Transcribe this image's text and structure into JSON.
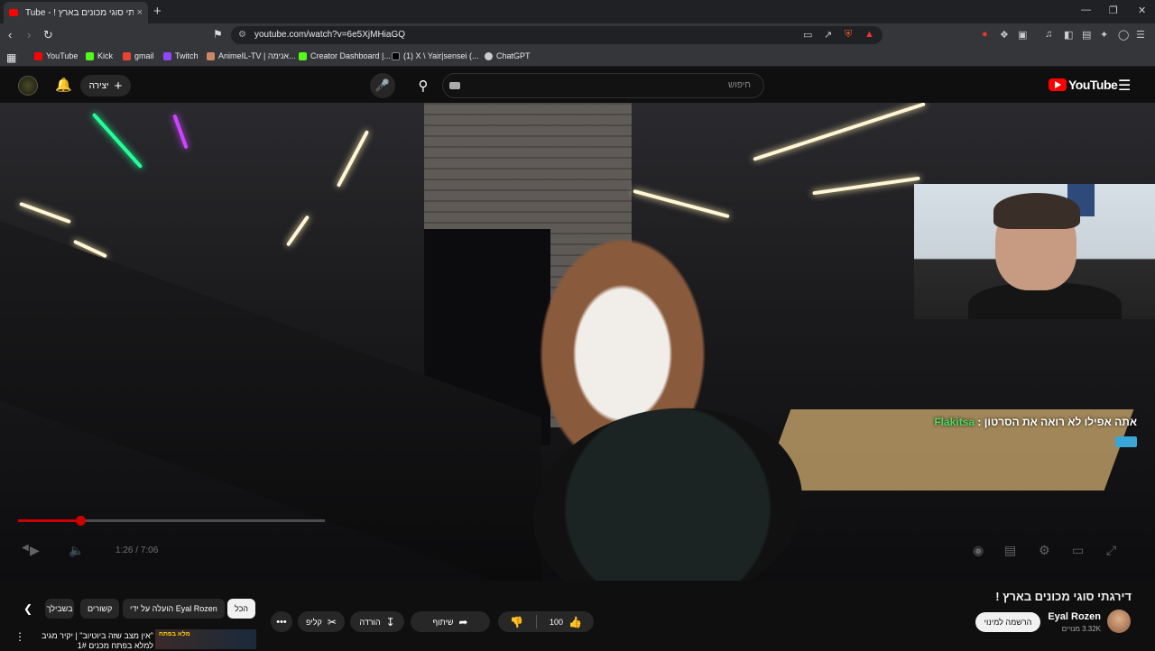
{
  "browser": {
    "tab_title": "Tube - ! דירגתי סוגי מכונים בארץ",
    "tab_close": "×",
    "new_tab": "+",
    "url": "youtube.com/watch?v=6e5XjMHiaGQ",
    "bookmarks": [
      "YouTube",
      "Kick",
      "gmail",
      "Twitch",
      "AnimeIL-TV | אנימה...",
      "Creator Dashboard |...",
      "(1) X \\ Yair|sensei (...",
      "ChatGPT"
    ]
  },
  "youtube": {
    "create_label": "יצירה",
    "search_placeholder": "חיפוש",
    "logo_text": "YouTube"
  },
  "player": {
    "time": "1:26 / 7:06",
    "progress_fraction": 0.202,
    "chat": {
      "username": "Flakitsa",
      "separator": ":",
      "message": "אתה אפילו לא רואה את הסרטון"
    }
  },
  "video": {
    "title": "דירגתי סוגי מכונים בארץ !",
    "channel_name": "Eyal Rozen",
    "subscribers": "3.32K מנויים",
    "subscribe_label": "הרשמה למינוי",
    "like_count": "100",
    "share_label": "שיתוף",
    "download_label": "הורדה",
    "clip_label": "קליפ",
    "more_label": "•••"
  },
  "recommendations": {
    "chips": [
      "הכל",
      "הועלה על ידי Eyal Rozen",
      "קשורים",
      "בשבילך"
    ],
    "first_title": "\"אין מצב שזה ביוטיוב\" | יקיר מגיב למלא בפתח מכנים 1#",
    "first_thumb_tag": "מלא בפתח"
  },
  "colors": {
    "accent": "#ff0000",
    "progress": "#cc0000",
    "chat_username": "#4cd964"
  }
}
